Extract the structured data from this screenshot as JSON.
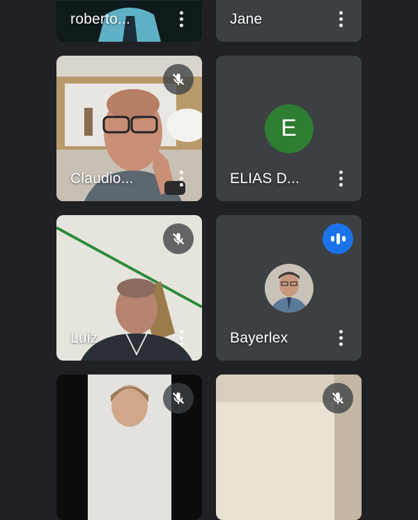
{
  "colors": {
    "background": "#202124",
    "tile": "#3c4043",
    "speaking_indicator": "#1a73e8",
    "avatar_e": "#2e7d32"
  },
  "participants": [
    {
      "name": "roberto...",
      "muted": false,
      "video": true
    },
    {
      "name": "Jane",
      "muted": false,
      "video": false
    },
    {
      "name": "Claudio...",
      "muted": true,
      "video": true
    },
    {
      "name": "ELIAS D...",
      "muted": false,
      "video": false,
      "avatar_letter": "E"
    },
    {
      "name": "Luiz",
      "muted": true,
      "video": true
    },
    {
      "name": "Bayerlex",
      "muted": false,
      "video": false,
      "speaking": true
    },
    {
      "name": "",
      "muted": true,
      "video": true
    },
    {
      "name": "",
      "muted": true,
      "video": true
    }
  ],
  "icons": {
    "mute": "mic-off-icon",
    "more": "more-vert-icon",
    "speaking": "audio-wave-icon"
  }
}
